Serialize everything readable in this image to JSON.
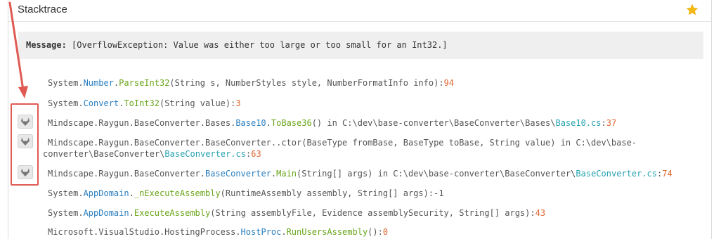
{
  "panel": {
    "title": "Stacktrace",
    "favorite_icon": "star-icon"
  },
  "message": {
    "label": "Message:",
    "text": " [OverflowException: Value was either too large or too small for an Int32.]"
  },
  "stacktrace": [
    {
      "parts": [
        {
          "t": "System.",
          "c": "plain"
        },
        {
          "t": "Number",
          "c": "blue"
        },
        {
          "t": ".",
          "c": "plain"
        },
        {
          "t": "ParseInt32",
          "c": "green"
        },
        {
          "t": "(String s, NumberStyles style, NumberFormatInfo info):",
          "c": "plain"
        },
        {
          "t": "94",
          "c": "orange"
        }
      ]
    },
    {
      "parts": [
        {
          "t": "System.",
          "c": "plain"
        },
        {
          "t": "Convert",
          "c": "blue"
        },
        {
          "t": ".",
          "c": "plain"
        },
        {
          "t": "ToInt32",
          "c": "green"
        },
        {
          "t": "(String value):",
          "c": "plain"
        },
        {
          "t": "3",
          "c": "orange"
        }
      ]
    },
    {
      "parts": [
        {
          "t": "Mindscape.Raygun.BaseConverter.Bases.",
          "c": "plain"
        },
        {
          "t": "Base10",
          "c": "blue"
        },
        {
          "t": ".",
          "c": "plain"
        },
        {
          "t": "ToBase36",
          "c": "green"
        },
        {
          "t": "() in C:\\dev\\base-converter\\BaseConverter\\Bases\\",
          "c": "plain"
        },
        {
          "t": "Base10.cs",
          "c": "teal"
        },
        {
          "t": ":",
          "c": "plain"
        },
        {
          "t": "37",
          "c": "orange"
        }
      ]
    },
    {
      "parts": [
        {
          "t": "Mindscape.Raygun.BaseConverter.BaseConverter..ctor(BaseType fromBase, BaseType toBase, String value) in C:\\dev\\base-",
          "c": "plain"
        }
      ],
      "continuation": [
        {
          "t": "converter\\BaseConverter\\",
          "c": "plain"
        },
        {
          "t": "BaseConverter.cs",
          "c": "teal"
        },
        {
          "t": ":",
          "c": "plain"
        },
        {
          "t": "63",
          "c": "orange"
        }
      ]
    },
    {
      "parts": [
        {
          "t": "Mindscape.Raygun.BaseConverter.",
          "c": "plain"
        },
        {
          "t": "BaseConverter",
          "c": "blue"
        },
        {
          "t": ".",
          "c": "plain"
        },
        {
          "t": "Main",
          "c": "green"
        },
        {
          "t": "(String[] args) in C:\\dev\\base-converter\\BaseConverter\\",
          "c": "plain"
        },
        {
          "t": "BaseConverter.cs",
          "c": "teal"
        },
        {
          "t": ":",
          "c": "plain"
        },
        {
          "t": "74",
          "c": "orange"
        }
      ]
    },
    {
      "parts": [
        {
          "t": "System.",
          "c": "plain"
        },
        {
          "t": "AppDomain",
          "c": "blue"
        },
        {
          "t": ".",
          "c": "plain"
        },
        {
          "t": "_nExecuteAssembly",
          "c": "green"
        },
        {
          "t": "(RuntimeAssembly assembly, String[] args):-1",
          "c": "plain"
        }
      ]
    },
    {
      "parts": [
        {
          "t": "System.",
          "c": "plain"
        },
        {
          "t": "AppDomain",
          "c": "blue"
        },
        {
          "t": ".",
          "c": "plain"
        },
        {
          "t": "ExecuteAssembly",
          "c": "green"
        },
        {
          "t": "(String assemblyFile, Evidence assemblySecurity, String[] args):",
          "c": "plain"
        },
        {
          "t": "43",
          "c": "orange"
        }
      ]
    },
    {
      "parts": [
        {
          "t": "Microsoft.VisualStudio.HostingProcess.",
          "c": "plain"
        },
        {
          "t": "HostProc",
          "c": "blue"
        },
        {
          "t": ".",
          "c": "plain"
        },
        {
          "t": "RunUsersAssembly",
          "c": "green"
        },
        {
          "t": "():",
          "c": "plain"
        },
        {
          "t": "0",
          "c": "orange"
        }
      ]
    }
  ],
  "source_link_buttons": [
    {
      "icon": "gitlab-icon"
    },
    {
      "icon": "gitlab-icon"
    },
    {
      "icon": "gitlab-icon"
    }
  ],
  "colors": {
    "type": "#2a7fc0",
    "method": "#6aa51a",
    "file": "#27a3b0",
    "line_number": "#e0662f",
    "annotation": "#e05a54",
    "star": "#f5b915"
  }
}
